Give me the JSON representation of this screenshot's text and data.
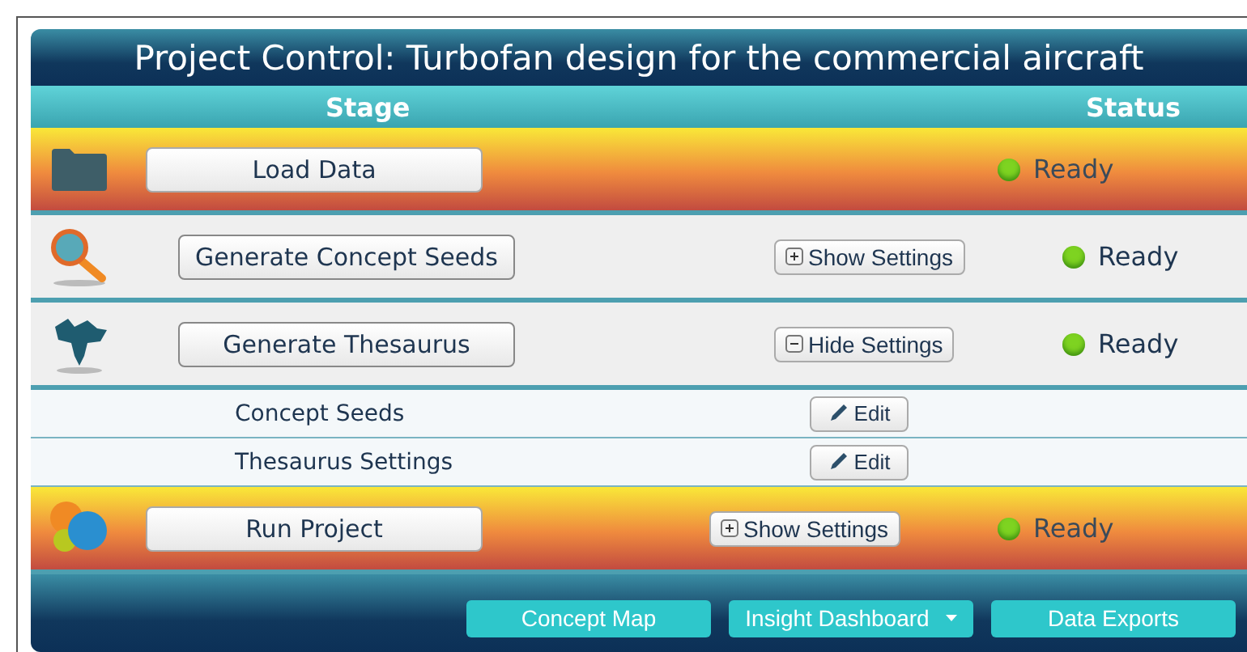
{
  "title": "Project Control: Turbofan design for the commercial aircraft",
  "columns": [
    "Stage",
    "Status"
  ],
  "stages": [
    {
      "kind": "folder",
      "highlighted": true,
      "action": "Load Data",
      "status": "Ready"
    },
    {
      "kind": "search",
      "highlighted": false,
      "action": "Generate Concept Seeds",
      "settings": {
        "label": "Show Settings",
        "expanded": false
      },
      "status": "Ready"
    },
    {
      "kind": "map",
      "highlighted": false,
      "action": "Generate Thesaurus",
      "settings": {
        "label": "Hide Settings",
        "expanded": true
      },
      "status": "Ready",
      "children": [
        {
          "label": "Concept Seeds",
          "button": "Edit"
        },
        {
          "label": "Thesaurus Settings",
          "button": "Edit"
        }
      ]
    },
    {
      "kind": "circles",
      "highlighted": true,
      "action": "Run Project",
      "settings": {
        "label": "Show Settings",
        "expanded": false
      },
      "status": "Ready"
    }
  ],
  "footer_buttons": [
    {
      "label": "Concept Map",
      "dropdown": false
    },
    {
      "label": "Insight Dashboard",
      "dropdown": true
    },
    {
      "label": "Data Exports",
      "dropdown": false
    }
  ]
}
